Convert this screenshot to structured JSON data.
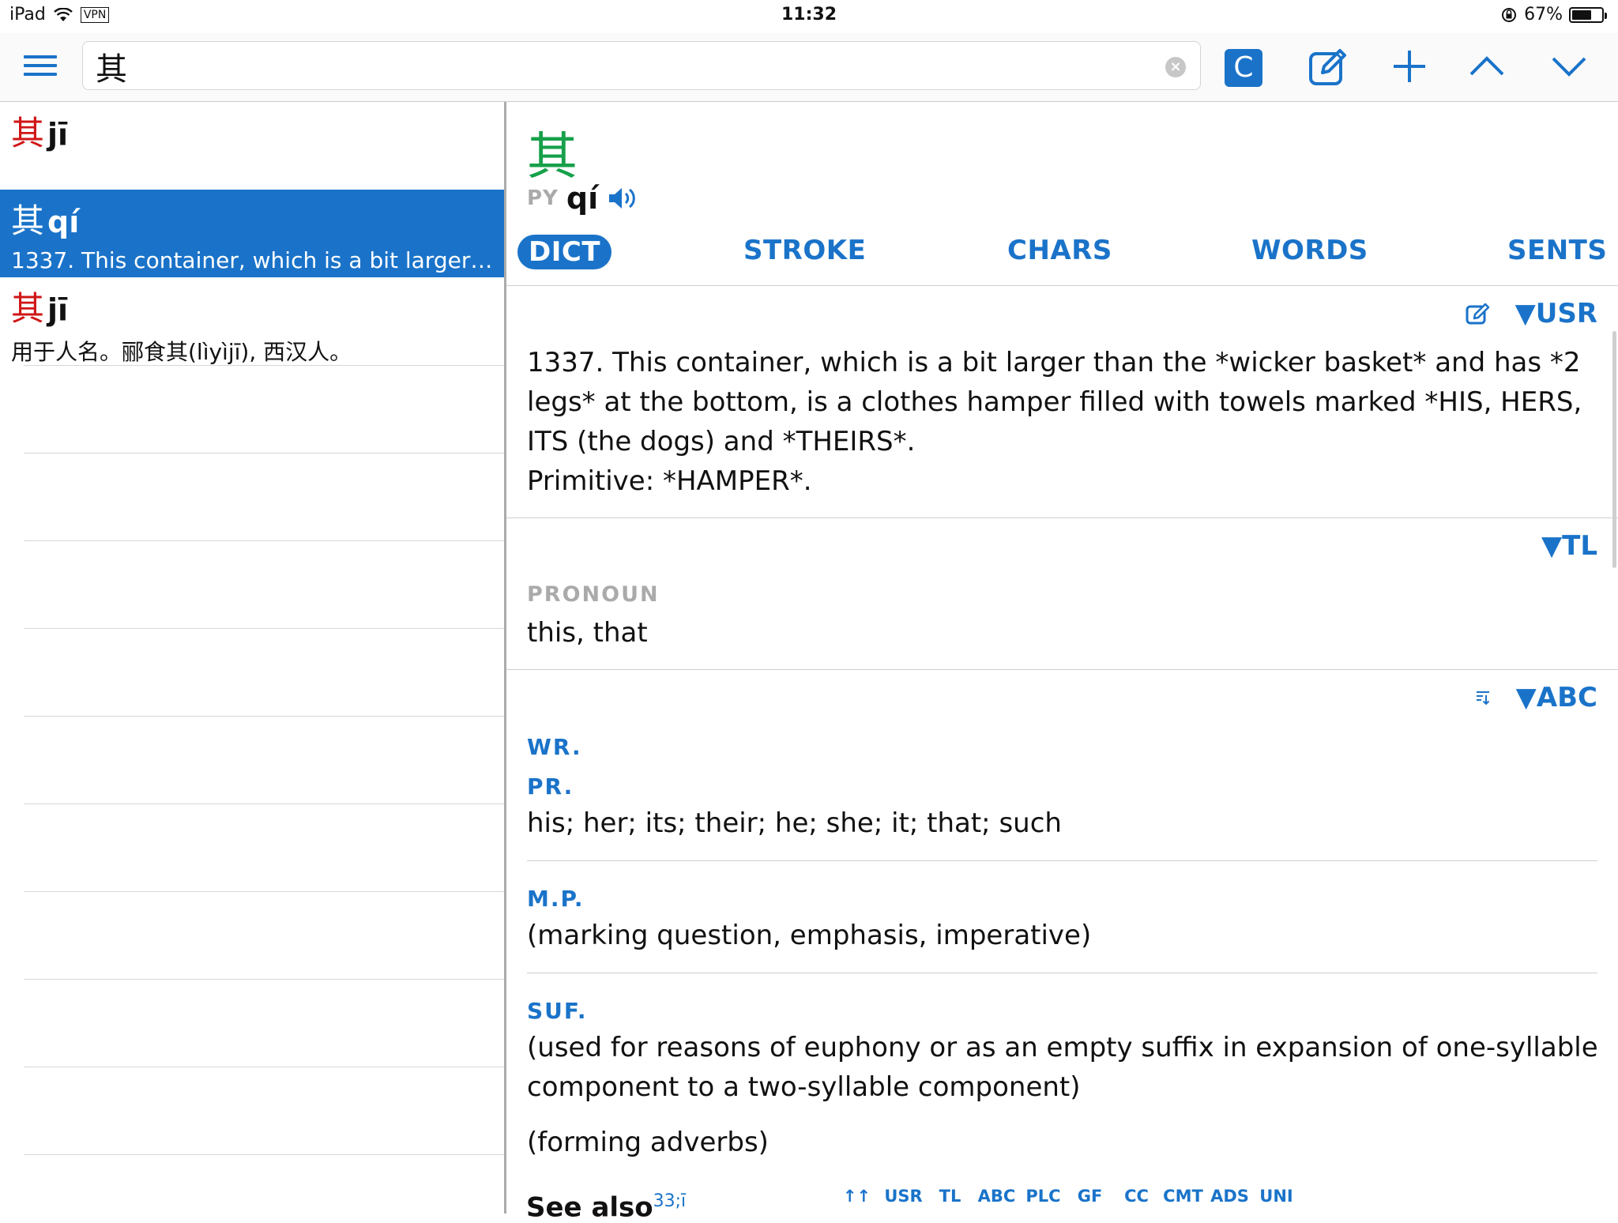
{
  "status": {
    "device": "iPad",
    "vpn": "VPN",
    "time": "11:32",
    "battery": "67%",
    "battery_level": 0.67
  },
  "search": {
    "value": "其"
  },
  "toolbar": {
    "c_label": "C"
  },
  "list": [
    {
      "hanzi": "其",
      "pinyin": "jī",
      "def": ""
    },
    {
      "hanzi": "其",
      "pinyin": "qí",
      "def": "1337. This container, which is a bit larger th…"
    },
    {
      "hanzi": "其",
      "pinyin": "jī",
      "def": "用于人名。郦食其(lìyìjī), 西汉人。"
    }
  ],
  "entry": {
    "hanzi": "其",
    "py_tag": "PY",
    "pinyin": "qí",
    "tabs": [
      "DICT",
      "STROKE",
      "CHARS",
      "WORDS",
      "SENTS"
    ],
    "usr_label": "▼USR",
    "usr_lines": [
      "1337. This container, which is a bit larger than the *wicker basket* and has *2",
      "legs* at the bottom, is a clothes hamper filled with towels marked *HIS, HERS,",
      "ITS (the dogs) and *THEIRS*.",
      "Primitive: *HAMPER*."
    ],
    "tl_label": "▼TL",
    "tl_pos": "PRONOUN",
    "tl_def": "this, that",
    "abc_label": "▼ABC",
    "abc_wr": "WR.",
    "abc_pr": "PR.",
    "abc_pr_def": "his; her; its; their; he; she; it; that; such",
    "abc_mp": "M.P.",
    "abc_mp_def": "(marking question, emphasis, imperative)",
    "abc_suf": "SUF.",
    "abc_suf_def1": "(used for reasons of euphony or as an empty suffix in expansion of one-syllable",
    "abc_suf_def1b": "component to a two-syllable component)",
    "abc_suf_def2": "(forming adverbs)",
    "see_also": "See also",
    "see_also_ref": "33;ī"
  },
  "jumpbar": [
    "↑↑",
    "USR",
    "TL",
    "ABC",
    "PLC",
    "GF",
    "CC",
    "CMT",
    "ADS",
    "UNI"
  ]
}
